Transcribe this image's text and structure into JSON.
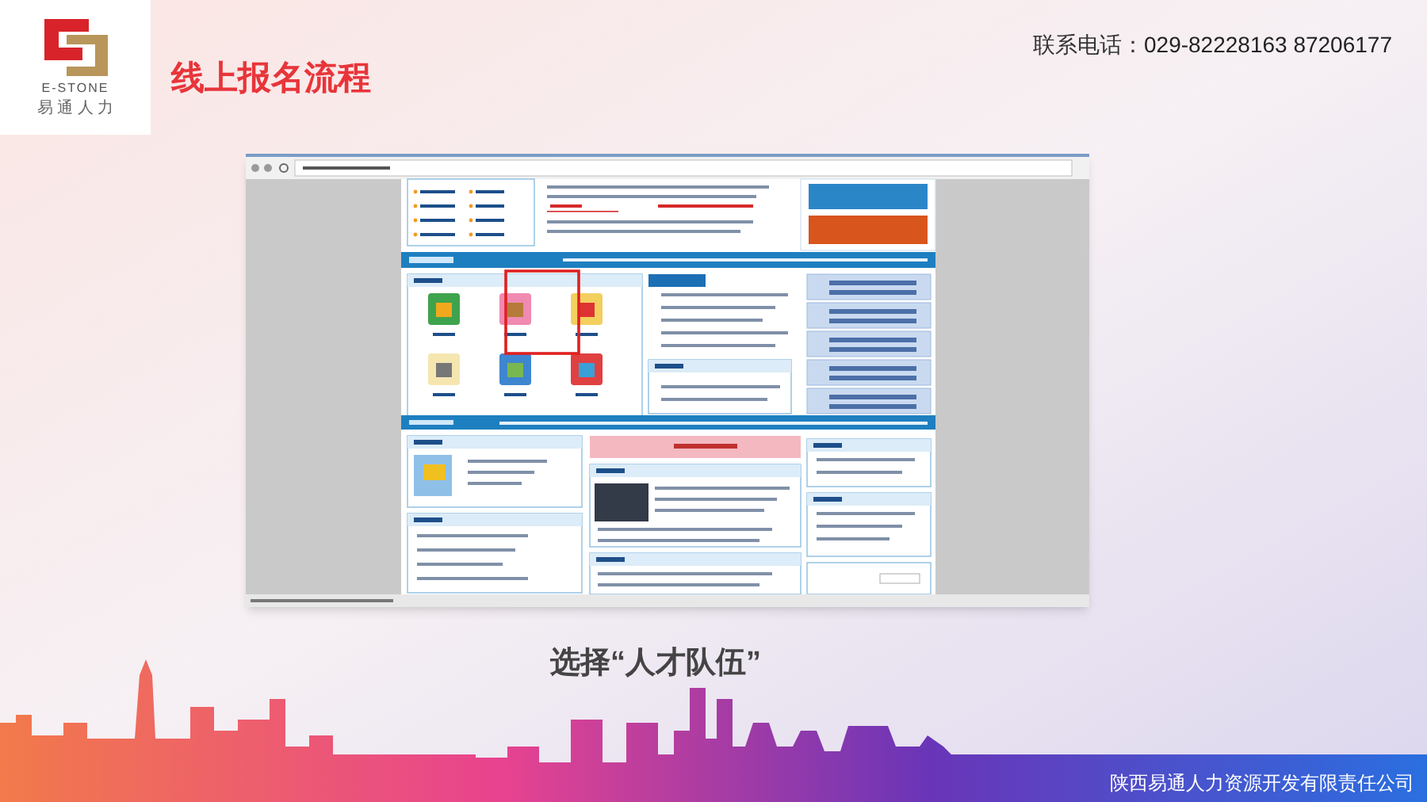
{
  "logo": {
    "brand": "E-STONE",
    "tagline": "易 通 人 力"
  },
  "title": "线上报名流程",
  "contact": {
    "label": "联系电话：",
    "number": "029-82228163 87206177"
  },
  "screenshot": {
    "highlight": true
  },
  "caption": "选择“人才队伍”",
  "footer": "陕西易通人力资源开发有限责任公司"
}
